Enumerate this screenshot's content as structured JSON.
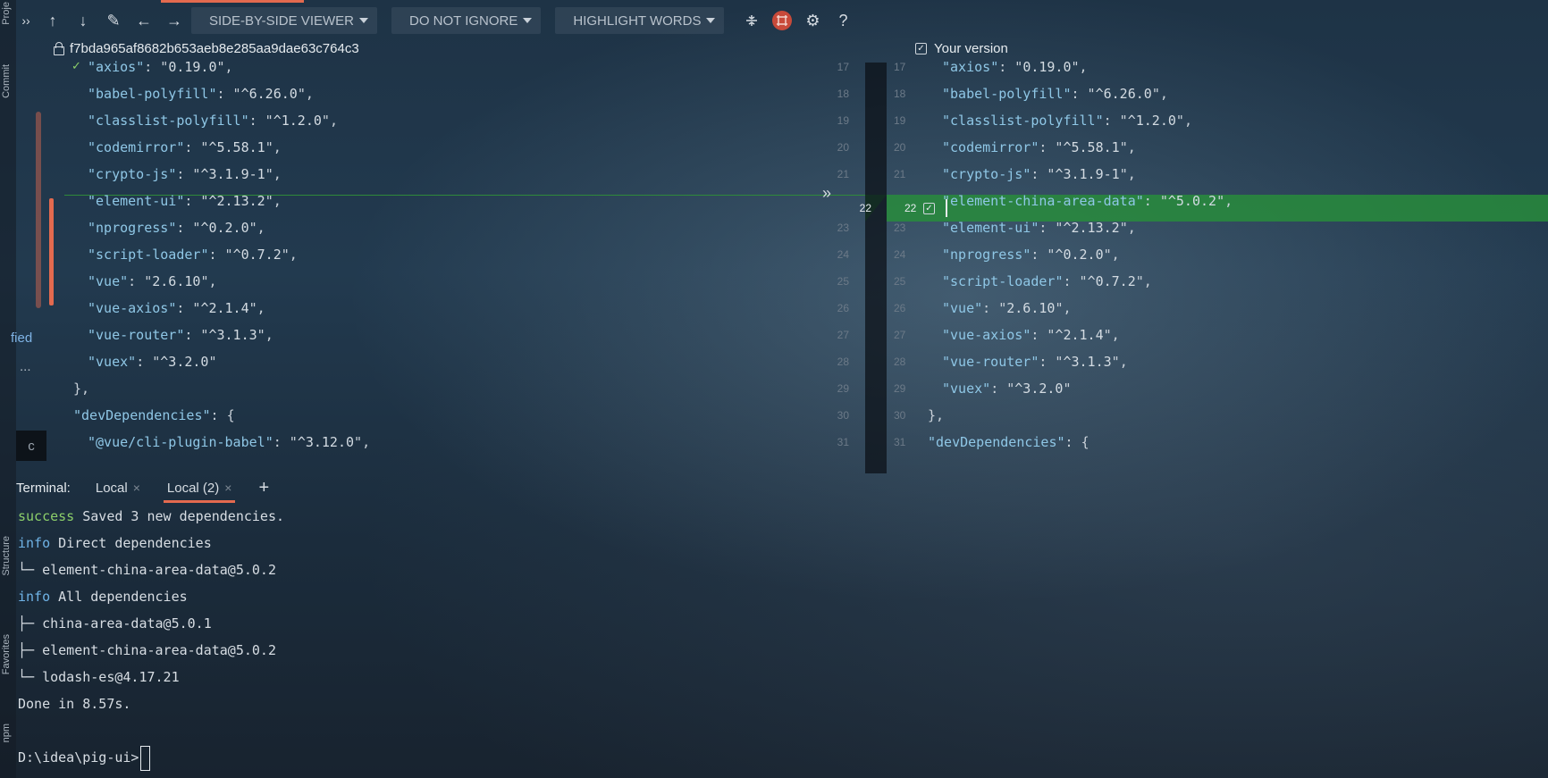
{
  "toolbar": {
    "viewer_mode": "SIDE-BY-SIDE VIEWER",
    "ignore_mode": "DO NOT IGNORE",
    "highlight_mode": "HIGHLIGHT WORDS",
    "help": "?"
  },
  "header": {
    "left_revision": "f7bda965af8682b653aeb8e285aa9dae63c764c3",
    "right_revision": "Your version"
  },
  "sidebar": {
    "commit_label": "Commit",
    "project_label": "Proje",
    "structure_label": "Structure",
    "favorites_label": "Favorites",
    "npm_label": "npm",
    "fied_text": "fied",
    "dots": "...",
    "dark_box_text": "c"
  },
  "diff": {
    "changed_line_number": "22",
    "left_lines": [
      {
        "num": "17",
        "indent": 2,
        "key": "axios",
        "val": "0.19.0",
        "tail": ","
      },
      {
        "num": "18",
        "indent": 2,
        "key": "babel-polyfill",
        "val": "^6.26.0",
        "tail": ","
      },
      {
        "num": "19",
        "indent": 2,
        "key": "classlist-polyfill",
        "val": "^1.2.0",
        "tail": ","
      },
      {
        "num": "20",
        "indent": 2,
        "key": "codemirror",
        "val": "^5.58.1",
        "tail": ","
      },
      {
        "num": "21",
        "indent": 2,
        "key": "crypto-js",
        "val": "^3.1.9-1",
        "tail": ","
      },
      {
        "num": "22",
        "indent": 2,
        "key": "element-ui",
        "val": "^2.13.2",
        "tail": ","
      },
      {
        "num": "23",
        "indent": 2,
        "key": "nprogress",
        "val": "^0.2.0",
        "tail": ","
      },
      {
        "num": "24",
        "indent": 2,
        "key": "script-loader",
        "val": "^0.7.2",
        "tail": ","
      },
      {
        "num": "25",
        "indent": 2,
        "key": "vue",
        "val": "2.6.10",
        "tail": ","
      },
      {
        "num": "26",
        "indent": 2,
        "key": "vue-axios",
        "val": "^2.1.4",
        "tail": ","
      },
      {
        "num": "27",
        "indent": 2,
        "key": "vue-router",
        "val": "^3.1.3",
        "tail": ","
      },
      {
        "num": "28",
        "indent": 2,
        "key": "vuex",
        "val": "^3.2.0",
        "tail": ""
      },
      {
        "num": "29",
        "indent": 1,
        "raw": "},"
      },
      {
        "num": "30",
        "indent": 1,
        "key": "devDependencies",
        "raw_tail": ": {"
      },
      {
        "num": "31",
        "indent": 2,
        "key": "@vue/cli-plugin-babel",
        "val": "^3.12.0",
        "tail": ","
      }
    ],
    "right_lines": [
      {
        "num": "17",
        "indent": 2,
        "key": "axios",
        "val": "0.19.0",
        "tail": ","
      },
      {
        "num": "18",
        "indent": 2,
        "key": "babel-polyfill",
        "val": "^6.26.0",
        "tail": ","
      },
      {
        "num": "19",
        "indent": 2,
        "key": "classlist-polyfill",
        "val": "^1.2.0",
        "tail": ","
      },
      {
        "num": "20",
        "indent": 2,
        "key": "codemirror",
        "val": "^5.58.1",
        "tail": ","
      },
      {
        "num": "21",
        "indent": 2,
        "key": "crypto-js",
        "val": "^3.1.9-1",
        "tail": ","
      },
      {
        "num": "22",
        "indent": 2,
        "key": "element-china-area-data",
        "val": "^5.0.2",
        "tail": ","
      },
      {
        "num": "23",
        "indent": 2,
        "key": "element-ui",
        "val": "^2.13.2",
        "tail": ","
      },
      {
        "num": "24",
        "indent": 2,
        "key": "nprogress",
        "val": "^0.2.0",
        "tail": ","
      },
      {
        "num": "25",
        "indent": 2,
        "key": "script-loader",
        "val": "^0.7.2",
        "tail": ","
      },
      {
        "num": "26",
        "indent": 2,
        "key": "vue",
        "val": "2.6.10",
        "tail": ","
      },
      {
        "num": "27",
        "indent": 2,
        "key": "vue-axios",
        "val": "^2.1.4",
        "tail": ","
      },
      {
        "num": "28",
        "indent": 2,
        "key": "vue-router",
        "val": "^3.1.3",
        "tail": ","
      },
      {
        "num": "29",
        "indent": 2,
        "key": "vuex",
        "val": "^3.2.0",
        "tail": ""
      },
      {
        "num": "30",
        "indent": 1,
        "raw": "},"
      },
      {
        "num": "31",
        "indent": 1,
        "key": "devDependencies",
        "raw_tail": ": {"
      }
    ]
  },
  "terminal": {
    "title": "Terminal:",
    "tabs": [
      {
        "label": "Local",
        "active": false
      },
      {
        "label": "Local (2)",
        "active": true
      }
    ],
    "lines": [
      {
        "prefix": "success",
        "prefix_color": "green",
        "text": " Saved 3 new dependencies."
      },
      {
        "prefix": "info",
        "prefix_color": "blue",
        "text": " Direct dependencies"
      },
      {
        "prefix": "",
        "text": "└─ element-china-area-data@5.0.2"
      },
      {
        "prefix": "info",
        "prefix_color": "blue",
        "text": " All dependencies"
      },
      {
        "prefix": "",
        "text": "├─ china-area-data@5.0.1"
      },
      {
        "prefix": "",
        "text": "├─ element-china-area-data@5.0.2"
      },
      {
        "prefix": "",
        "text": "└─ lodash-es@4.17.21"
      },
      {
        "prefix": "",
        "text": "Done in 8.57s."
      },
      {
        "prefix": "",
        "text": ""
      },
      {
        "prefix": "",
        "text": "D:\\idea\\pig-ui>"
      }
    ]
  }
}
